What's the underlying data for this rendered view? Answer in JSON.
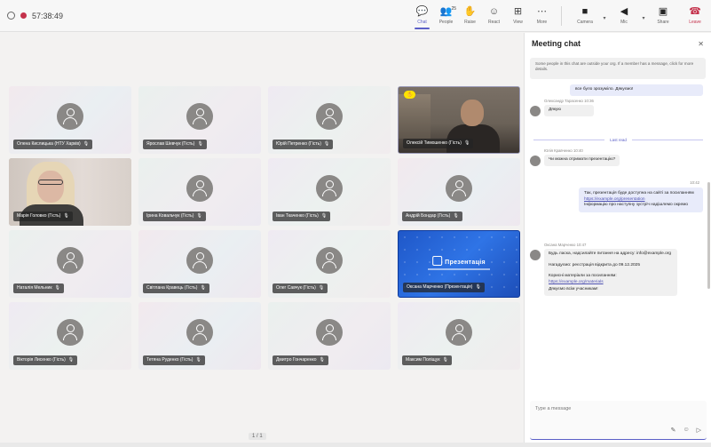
{
  "topbar": {
    "timer": "57:38:49",
    "controls": [
      {
        "id": "chat",
        "icon": "💬",
        "label": "Chat",
        "active": true
      },
      {
        "id": "people",
        "icon": "👥",
        "label": "People",
        "badge": "25"
      },
      {
        "id": "raise",
        "icon": "✋",
        "label": "Raise"
      },
      {
        "id": "react",
        "icon": "☺",
        "label": "React"
      },
      {
        "id": "view",
        "icon": "⊞",
        "label": "View"
      },
      {
        "id": "more",
        "icon": "⋯",
        "label": "More"
      }
    ],
    "media": [
      {
        "id": "camera",
        "icon": "■",
        "label": "Camera"
      },
      {
        "id": "mic",
        "icon": "◀",
        "label": "Mic"
      },
      {
        "id": "share",
        "icon": "▣",
        "label": "Share"
      }
    ],
    "leave": {
      "icon": "☎",
      "label": "Leave"
    }
  },
  "participants": [
    {
      "name": "Олена Кислицька (НТУ Харків)",
      "kind": "avatar"
    },
    {
      "name": "Ярослав Шевчук (Гість)",
      "kind": "avatar"
    },
    {
      "name": "Юрій Петренко (Гість)",
      "kind": "avatar"
    },
    {
      "name": "Олексій Тимошенко (Гість)",
      "kind": "video-man"
    },
    {
      "name": "Марія Головко (Гість)",
      "kind": "video-woman"
    },
    {
      "name": "Ірина Ковальчук (Гість)",
      "kind": "avatar"
    },
    {
      "name": "Іван Ткаченко (Гість)",
      "kind": "avatar"
    },
    {
      "name": "Андрій Бондар (Гість)",
      "kind": "avatar"
    },
    {
      "name": "Наталія Мельник",
      "kind": "avatar"
    },
    {
      "name": "Світлана Кравець (Гість)",
      "kind": "avatar"
    },
    {
      "name": "Олег Савчук (Гість)",
      "kind": "avatar"
    },
    {
      "name": "Оксана Марченко (Презентація)",
      "kind": "share",
      "share_title": "Презентація"
    },
    {
      "name": "Вікторія Лисенко (Гість)",
      "kind": "avatar"
    },
    {
      "name": "Тетяна Руденко (Гість)",
      "kind": "avatar"
    },
    {
      "name": "Дмитро Гончаренко",
      "kind": "avatar"
    },
    {
      "name": "Максим Поліщук",
      "kind": "avatar"
    }
  ],
  "pager": {
    "label": "1 / 1"
  },
  "chat": {
    "title": "Meeting chat",
    "notice": "Some people in this chat are outside your org. If a member has a message, click for more details.",
    "messages": [
      {
        "type": "out-cont",
        "text": "все було зрозуміло. Дякуємо!"
      },
      {
        "type": "in",
        "meta": "Олександр Тарасенко 10:36",
        "text": "Дякую"
      },
      {
        "type": "divider",
        "text": "Last read"
      },
      {
        "type": "in",
        "meta": "Юлія Кравченко 10:40",
        "text": "Чи можна отримати презентацію?"
      },
      {
        "type": "out",
        "meta": "10:42",
        "text": "Так, презентація буде доступна на сайті за посиланням",
        "link": "https://example.org/presentation",
        "text2": "Інформацію про наступну зустріч надішлемо окремо"
      },
      {
        "type": "in",
        "meta": "Оксана Марченко 10:47",
        "text": "Будь ласка, надсилайте питання на адресу: info@example.org",
        "text2": "Нагадуємо: реєстрація відкрита до 09.12.2025",
        "text3": "Корисні матеріали за посиланням:",
        "link": "https://example.org/materials",
        "text4": "Дякуємо всім учасникам!"
      }
    ],
    "compose": {
      "placeholder": "Type a message"
    },
    "tools": {
      "format": "✎",
      "emoji": "☺",
      "send": "▷"
    }
  }
}
